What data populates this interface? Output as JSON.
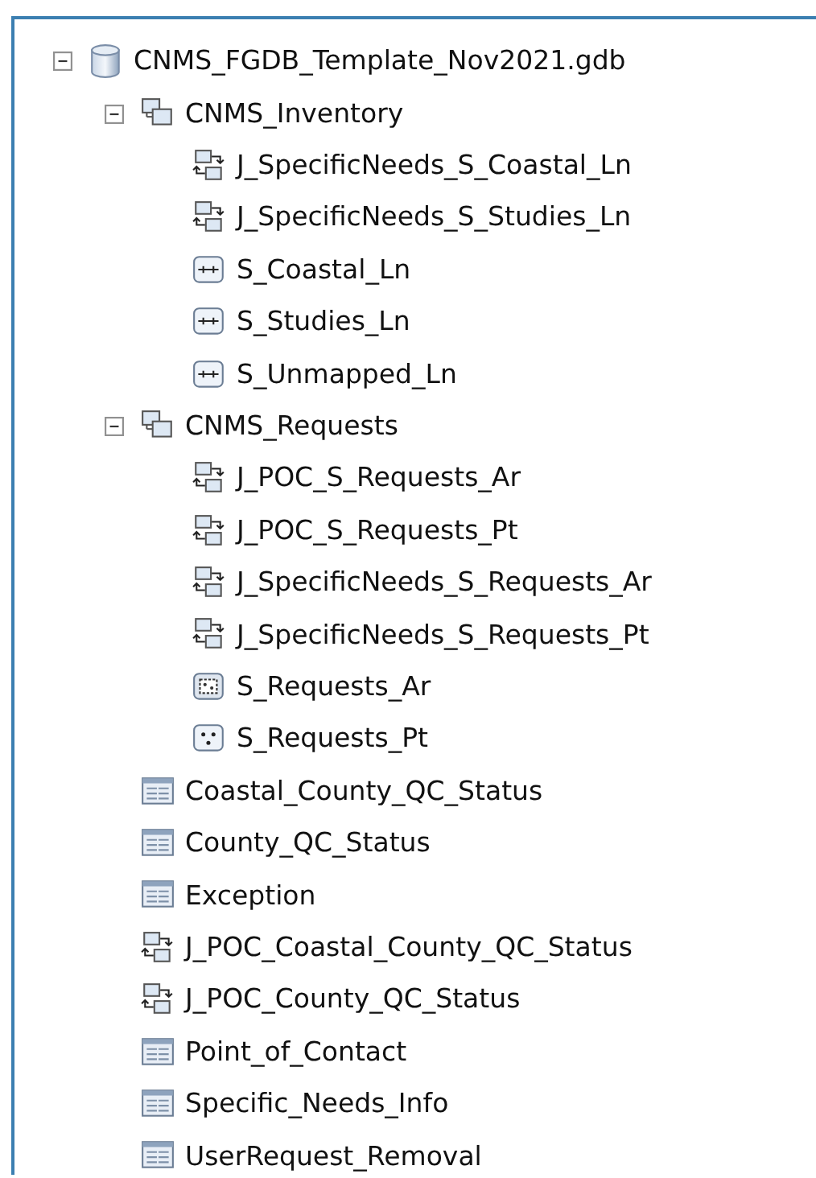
{
  "tree": [
    {
      "label": "CNMS_FGDB_Template_Nov2021.gdb",
      "kind": "database",
      "expanded": true,
      "children": [
        {
          "label": "CNMS_Inventory",
          "kind": "dataset",
          "expanded": true,
          "children": [
            {
              "label": "J_SpecificNeeds_S_Coastal_Ln",
              "kind": "relationship"
            },
            {
              "label": "J_SpecificNeeds_S_Studies_Ln",
              "kind": "relationship"
            },
            {
              "label": "S_Coastal_Ln",
              "kind": "line"
            },
            {
              "label": "S_Studies_Ln",
              "kind": "line"
            },
            {
              "label": "S_Unmapped_Ln",
              "kind": "line"
            }
          ]
        },
        {
          "label": "CNMS_Requests",
          "kind": "dataset",
          "expanded": true,
          "children": [
            {
              "label": "J_POC_S_Requests_Ar",
              "kind": "relationship"
            },
            {
              "label": "J_POC_S_Requests_Pt",
              "kind": "relationship"
            },
            {
              "label": "J_SpecificNeeds_S_Requests_Ar",
              "kind": "relationship"
            },
            {
              "label": "J_SpecificNeeds_S_Requests_Pt",
              "kind": "relationship"
            },
            {
              "label": "S_Requests_Ar",
              "kind": "polygon"
            },
            {
              "label": "S_Requests_Pt",
              "kind": "point"
            }
          ]
        },
        {
          "label": "Coastal_County_QC_Status",
          "kind": "table"
        },
        {
          "label": "County_QC_Status",
          "kind": "table"
        },
        {
          "label": "Exception",
          "kind": "table"
        },
        {
          "label": "J_POC_Coastal_County_QC_Status",
          "kind": "relationship"
        },
        {
          "label": "J_POC_County_QC_Status",
          "kind": "relationship"
        },
        {
          "label": "Point_of_Contact",
          "kind": "table"
        },
        {
          "label": "Specific_Needs_Info",
          "kind": "table"
        },
        {
          "label": "UserRequest_Removal",
          "kind": "table"
        }
      ]
    }
  ]
}
